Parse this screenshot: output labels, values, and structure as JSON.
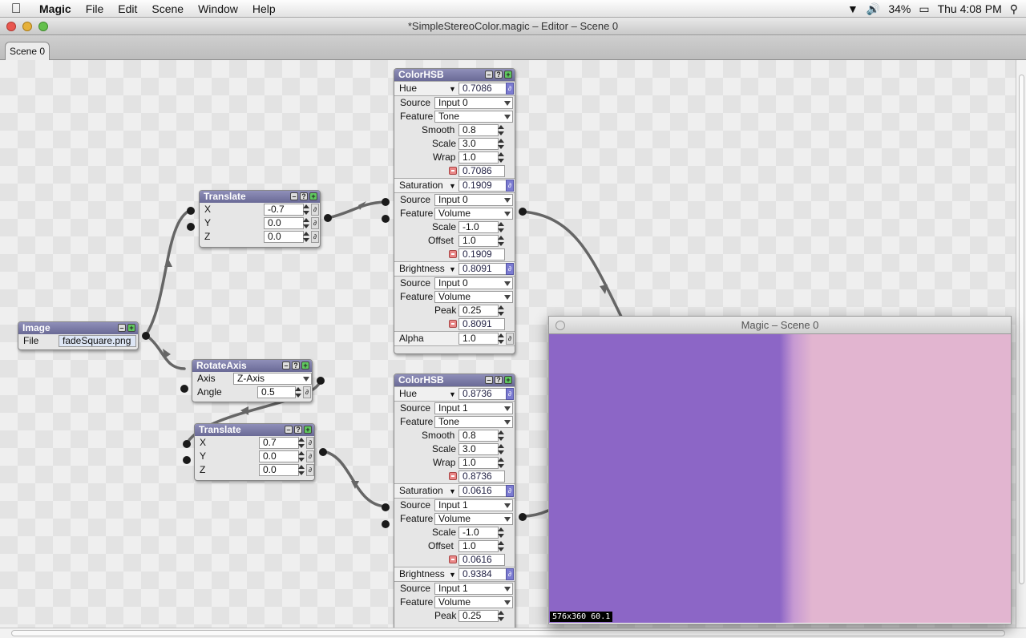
{
  "menubar": {
    "app": "Magic",
    "items": [
      "File",
      "Edit",
      "Scene",
      "Window",
      "Help"
    ],
    "battery": "34%",
    "clock": "Thu 4:08 PM"
  },
  "window": {
    "title": "*SimpleStereoColor.magic – Editor – Scene 0"
  },
  "tabs": [
    {
      "label": "Scene 0"
    }
  ],
  "nodes": {
    "image": {
      "title": "Image",
      "file_label": "File",
      "file_value": "fadeSquare.png"
    },
    "translate1": {
      "title": "Translate",
      "x_label": "X",
      "x": "-0.7",
      "y_label": "Y",
      "y": "0.0",
      "z_label": "Z",
      "z": "0.0"
    },
    "rotate": {
      "title": "RotateAxis",
      "axis_label": "Axis",
      "axis": "Z-Axis",
      "angle_label": "Angle",
      "angle": "0.5"
    },
    "translate2": {
      "title": "Translate",
      "x_label": "X",
      "x": "0.7",
      "y_label": "Y",
      "y": "0.0",
      "z_label": "Z",
      "z": "0.0"
    },
    "color1": {
      "title": "ColorHSB",
      "hue": {
        "label": "Hue",
        "value": "0.7086",
        "source_label": "Source",
        "source": "Input 0",
        "feature_label": "Feature",
        "feature": "Tone",
        "smooth_label": "Smooth",
        "smooth": "0.8",
        "scale_label": "Scale",
        "scale": "3.0",
        "wrap_label": "Wrap",
        "wrap": "1.0",
        "out": "0.7086"
      },
      "sat": {
        "label": "Saturation",
        "value": "0.1909",
        "source_label": "Source",
        "source": "Input 0",
        "feature_label": "Feature",
        "feature": "Volume",
        "scale_label": "Scale",
        "scale": "-1.0",
        "offset_label": "Offset",
        "offset": "1.0",
        "out": "0.1909"
      },
      "bri": {
        "label": "Brightness",
        "value": "0.8091",
        "source_label": "Source",
        "source": "Input 0",
        "feature_label": "Feature",
        "feature": "Volume",
        "peak_label": "Peak",
        "peak": "0.25",
        "out": "0.8091"
      },
      "alpha": {
        "label": "Alpha",
        "value": "1.0"
      }
    },
    "color2": {
      "title": "ColorHSB",
      "hue": {
        "label": "Hue",
        "value": "0.8736",
        "source_label": "Source",
        "source": "Input 1",
        "feature_label": "Feature",
        "feature": "Tone",
        "smooth_label": "Smooth",
        "smooth": "0.8",
        "scale_label": "Scale",
        "scale": "3.0",
        "wrap_label": "Wrap",
        "wrap": "1.0",
        "out": "0.8736"
      },
      "sat": {
        "label": "Saturation",
        "value": "0.0616",
        "source_label": "Source",
        "source": "Input 1",
        "feature_label": "Feature",
        "feature": "Volume",
        "scale_label": "Scale",
        "scale": "-1.0",
        "offset_label": "Offset",
        "offset": "1.0",
        "out": "0.0616"
      },
      "bri": {
        "label": "Brightness",
        "value": "0.9384",
        "source_label": "Source",
        "source": "Input 1",
        "feature_label": "Feature",
        "feature": "Volume",
        "peak_label": "Peak",
        "peak": "0.25"
      }
    }
  },
  "preview": {
    "title": "Magic – Scene 0",
    "status": "576x360 60.1",
    "colors": {
      "left": "#8c66c6",
      "right": "#e2b5d0"
    }
  }
}
